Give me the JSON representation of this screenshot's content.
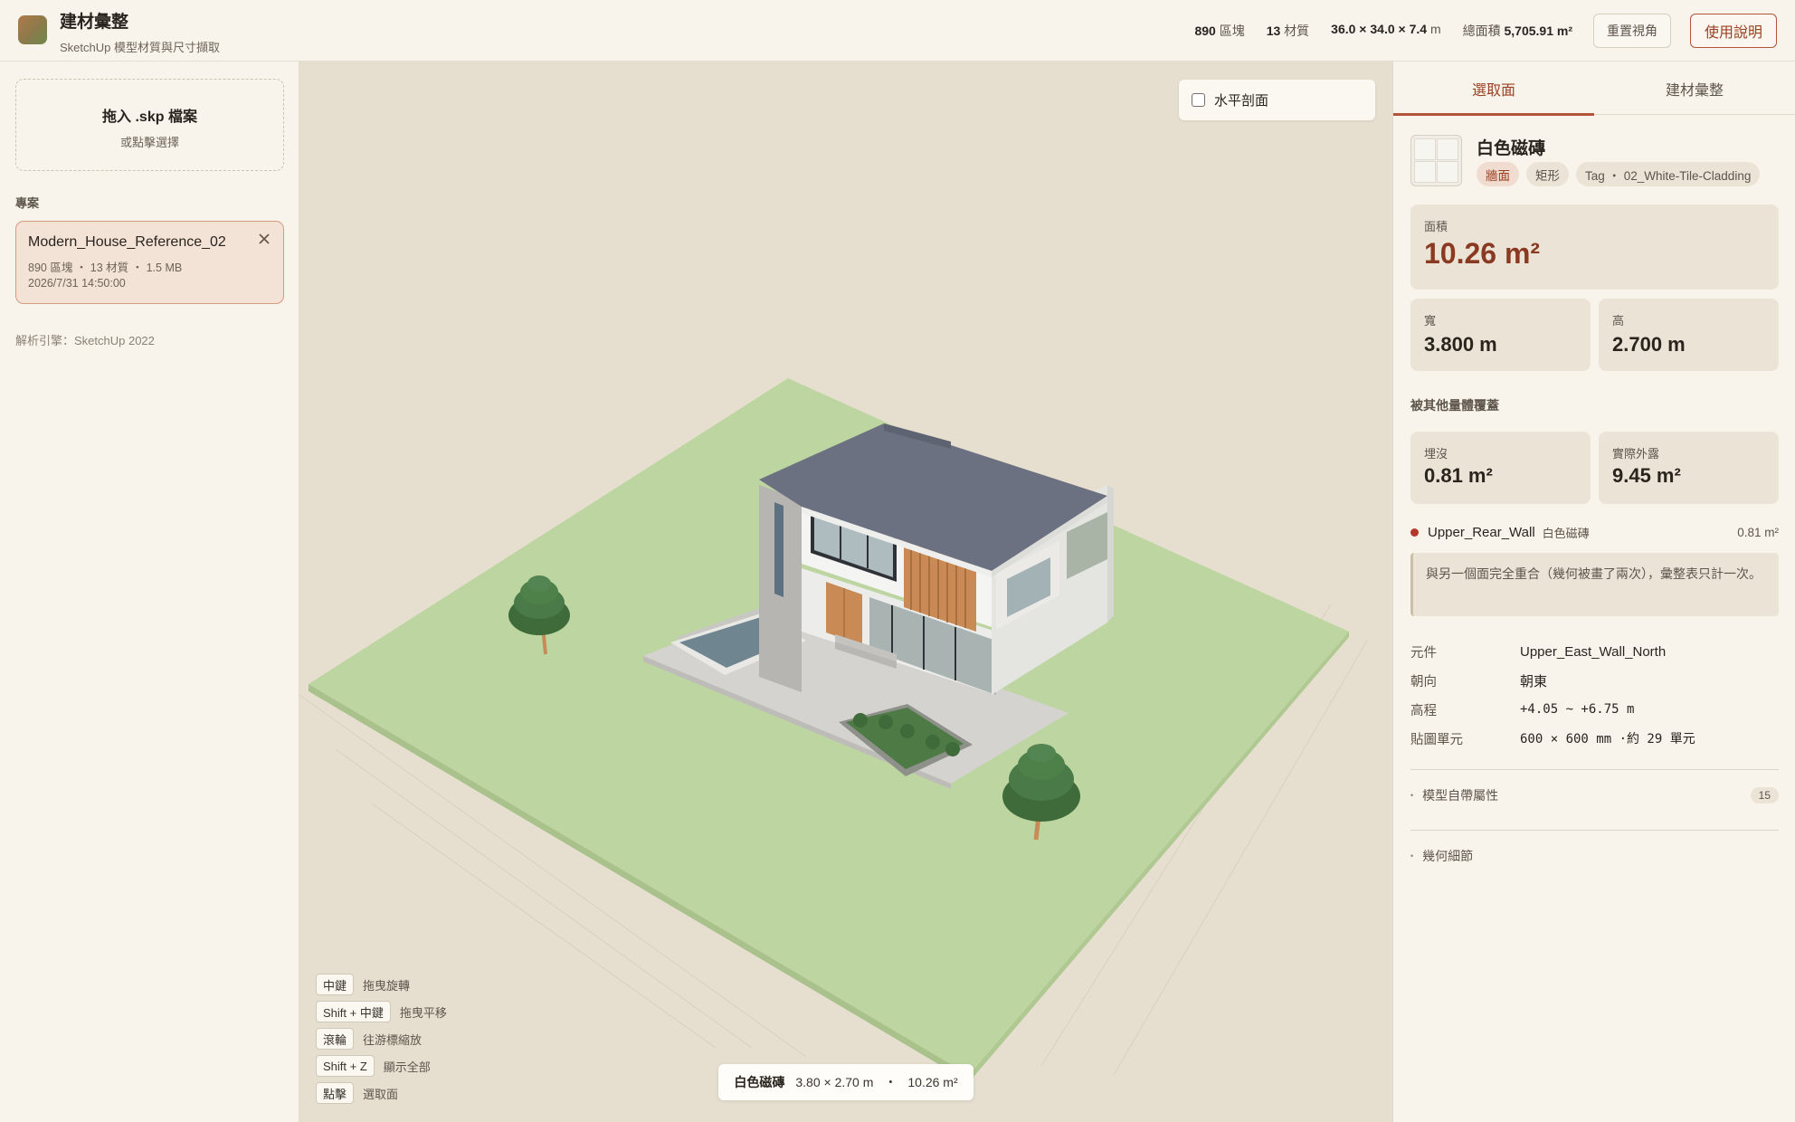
{
  "app": {
    "title": "建材彙整",
    "subtitle": "SketchUp 模型材質與尺寸擷取"
  },
  "header": {
    "stats": {
      "blocks_count": "890",
      "blocks_label": "區塊",
      "materials_count": "13",
      "materials_label": "材質",
      "dims": "36.0 × 34.0 × 7.4",
      "dims_unit": "m",
      "total_area_label": "總面積",
      "total_area_value": "5,705.91 m²"
    },
    "reset_view_label": "重置視角",
    "help_label": "使用說明"
  },
  "sidebar": {
    "dropzone_title": "拖入 .skp 檔案",
    "dropzone_hint": "或點擊選擇",
    "section_label": "專案",
    "project": {
      "name": "Modern_House_Reference_02",
      "meta": "890 區塊 ・ 13 材質 ・ 1.5 MB",
      "date": "2026/7/31 14:50:00"
    },
    "engine_label": "解析引擎：SketchUp 2022"
  },
  "viewport": {
    "section_toggle_label": "水平剖面",
    "section_toggle_checked": false,
    "hints": [
      {
        "key": "中鍵",
        "action": "拖曳旋轉"
      },
      {
        "key": "Shift + 中鍵",
        "action": "拖曳平移"
      },
      {
        "key": "滾輪",
        "action": "往游標縮放"
      },
      {
        "key": "Shift + Z",
        "action": "顯示全部"
      },
      {
        "key": "點擊",
        "action": "選取面"
      }
    ],
    "status": {
      "material": "白色磁磚",
      "dims": "3.80 × 2.70 m",
      "area": "10.26 m²"
    },
    "colors": {
      "ground": "#bdd5a0",
      "roof": "#6b7180",
      "walls": "#f4f4f2",
      "wood": "#c98a55",
      "tree": "#4a7a48"
    }
  },
  "panel": {
    "tabs": [
      "選取面",
      "建材彙整"
    ],
    "active_tab": 0,
    "material_name": "白色磁磚",
    "tags": [
      "牆面",
      "矩形",
      "Tag ・ 02_White-Tile-Cladding"
    ],
    "area_label": "面積",
    "area_value": "10.26 m²",
    "width_label": "寬",
    "width_value": "3.800 m",
    "height_label": "高",
    "height_value": "2.700 m",
    "covered_heading": "被其他量體覆蓋",
    "buried_label": "埋沒",
    "buried_value": "0.81 m²",
    "exposed_label": "實際外露",
    "exposed_value": "9.45 m²",
    "overlap": {
      "name": "Upper_Rear_Wall",
      "material": "白色磁磚",
      "area": "0.81 m²"
    },
    "note": "與另一個面完全重合（幾何被畫了兩次），彙整表只計一次。",
    "properties": [
      {
        "key": "元件",
        "value": "Upper_East_Wall_North"
      },
      {
        "key": "朝向",
        "value": "朝東"
      },
      {
        "key": "高程",
        "value": "+4.05 ~ +6.75 m"
      },
      {
        "key": "貼圖單元",
        "value": "600 × 600 mm ·約 29 單元"
      }
    ],
    "model_props_label": "模型自帶屬性",
    "model_props_count": "15",
    "geometry_label": "幾何細節"
  }
}
